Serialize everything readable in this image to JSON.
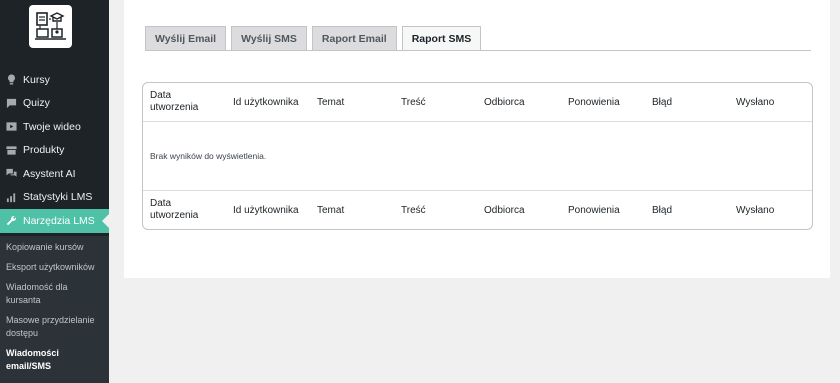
{
  "sidebar": {
    "menu": [
      {
        "label": "Kursy",
        "icon": "lightbulb-icon"
      },
      {
        "label": "Quizy",
        "icon": "chat-icon"
      },
      {
        "label": "Twoje wideo",
        "icon": "video-icon"
      },
      {
        "label": "Produkty",
        "icon": "archive-icon"
      },
      {
        "label": "Asystent AI",
        "icon": "comments-icon"
      },
      {
        "label": "Statystyki LMS",
        "icon": "bar-chart-icon"
      },
      {
        "label": "Narzędzia LMS",
        "icon": "wrench-icon"
      }
    ],
    "submenu": [
      {
        "label": "Kopiowanie kursów"
      },
      {
        "label": "Eksport użytkowników"
      },
      {
        "label": "Wiadomość dla kursanta"
      },
      {
        "label": "Masowe przydzielanie dostępu"
      },
      {
        "label": "Wiadomości email/SMS"
      }
    ]
  },
  "tabs": [
    "Wyślij Email",
    "Wyślij SMS",
    "Raport Email",
    "Raport SMS"
  ],
  "active_tab": "Raport SMS",
  "table": {
    "columns": [
      "Data utworzenia",
      "Id użytkownika",
      "Temat",
      "Treść",
      "Odbiorca",
      "Ponowienia",
      "Błąd",
      "Wysłano"
    ],
    "empty_message": "Brak wyników do wyświetlenia."
  },
  "colors": {
    "accent": "#4fc1a6",
    "sidebar": "#1d2327"
  }
}
